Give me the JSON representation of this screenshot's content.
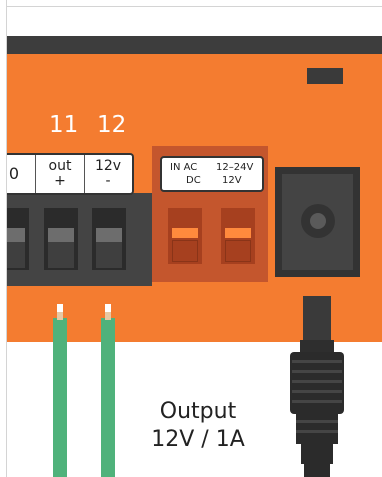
{
  "pins": {
    "pin_11": "11",
    "pin_12": "12"
  },
  "terminal_labels": {
    "partial": "0",
    "out_top": "out",
    "out_bottom": "+",
    "v12_top": "12v",
    "v12_bottom": "-"
  },
  "power_label": {
    "in_ac": "IN AC",
    "dc": "DC",
    "range_ac": "12–24V",
    "range_dc": "12V"
  },
  "output": {
    "line1": "Output",
    "line2": "12V / 1A"
  },
  "colors": {
    "board": "#f47c30",
    "terminal_dark": "#444444",
    "power_block": "#c4562d",
    "wire": "#4fb27b",
    "jack": "#333333"
  }
}
